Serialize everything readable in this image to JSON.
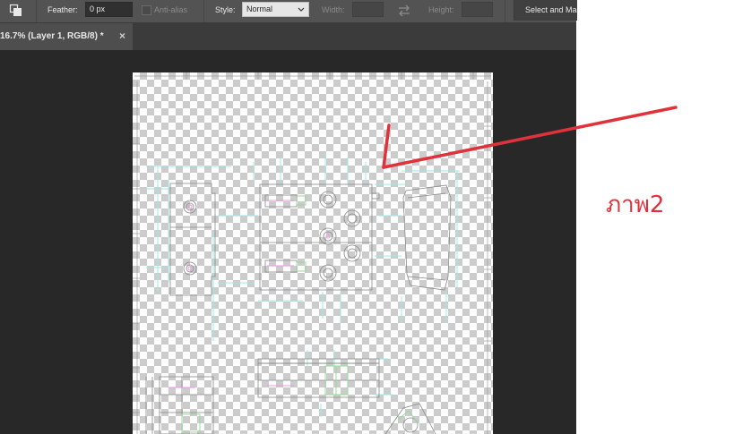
{
  "options_bar": {
    "feather_label": "Feather:",
    "feather_value": "0 px",
    "anti_alias_label": "Anti-alias",
    "anti_alias_checked": false,
    "style_label": "Style:",
    "style_value": "Normal",
    "width_label": "Width:",
    "height_label": "Height:",
    "select_mask_label": "Select and Mask...",
    "icons": [
      "selection-mode-icon",
      "swap-arrows-icon",
      "chevron-down-icon"
    ]
  },
  "document_tab": {
    "title": "16.7% (Layer 1, RGB/8) *",
    "close_glyph": "×"
  },
  "annotation": {
    "text": "ภาพ2",
    "color": "#e0323a"
  },
  "colors": {
    "workspace": "#282828",
    "options_bar": "#535353",
    "tab_bar": "#3b3b3b",
    "active_tab": "#4e4e4e",
    "drawing_cyan": "#9ee8e4",
    "drawing_gray": "#8a8a8a",
    "drawing_magenta": "#e89ae0",
    "drawing_green": "#9ad89a"
  }
}
